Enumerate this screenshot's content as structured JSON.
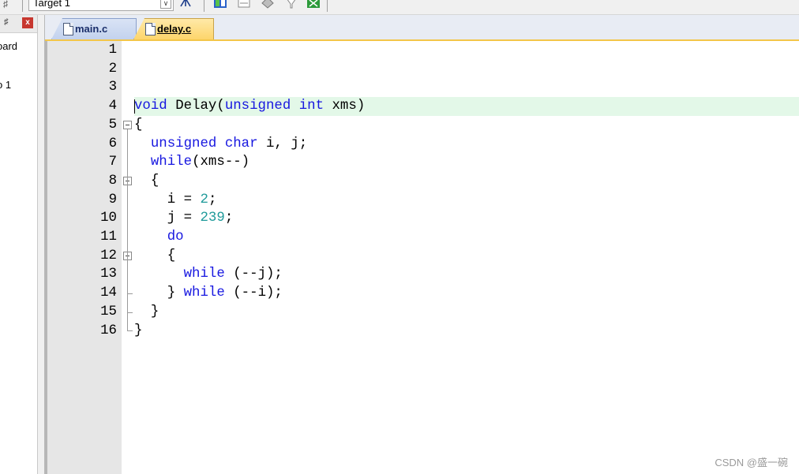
{
  "toolbar": {
    "target_label": "Target 1",
    "icons": [
      "pin-icon",
      "project-tree-icon",
      "manage-components-icon",
      "options-icon",
      "download-icon",
      "rte-icon",
      "pack-installer-icon"
    ]
  },
  "project_panel": {
    "items": [
      "oard",
      "o 1"
    ]
  },
  "tabs": [
    {
      "label": "main.c",
      "active": false
    },
    {
      "label": "delay.c",
      "active": true
    }
  ],
  "editor": {
    "active_line": 4,
    "lines": [
      {
        "n": "1",
        "code": ""
      },
      {
        "n": "2",
        "code": ""
      },
      {
        "n": "3",
        "code": ""
      },
      {
        "n": "4",
        "code": "void Delay(unsigned int xms)"
      },
      {
        "n": "5",
        "code": "{"
      },
      {
        "n": "6",
        "code": "  unsigned char i, j;"
      },
      {
        "n": "7",
        "code": "  while(xms--)"
      },
      {
        "n": "8",
        "code": "  {"
      },
      {
        "n": "9",
        "code": "    i = 2;"
      },
      {
        "n": "10",
        "code": "    j = 239;"
      },
      {
        "n": "11",
        "code": "    do"
      },
      {
        "n": "12",
        "code": "    {"
      },
      {
        "n": "13",
        "code": "      while (--j);"
      },
      {
        "n": "14",
        "code": "    } while (--i);"
      },
      {
        "n": "15",
        "code": "  }"
      },
      {
        "n": "16",
        "code": "}"
      }
    ]
  },
  "colors": {
    "keyword": "#1717e0",
    "number": "#1e9a9a",
    "active_line": "#e3f8e8",
    "active_tab": "#fdd56b"
  },
  "watermark": "CSDN @盛一碗"
}
